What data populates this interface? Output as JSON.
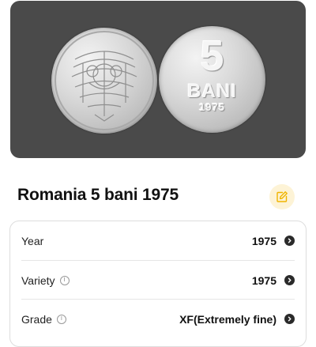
{
  "coin_image": {
    "reverse_value": "5",
    "reverse_unit": "BANI",
    "reverse_year": "1975"
  },
  "title": "Romania 5 bani 1975",
  "details": [
    {
      "label": "Year",
      "value": "1975",
      "info": false
    },
    {
      "label": "Variety",
      "value": "1975",
      "info": true
    },
    {
      "label": "Grade",
      "value": "XF(Extremely fine)",
      "info": true
    }
  ],
  "icons": {
    "edit": "edit-icon",
    "info": "info-icon",
    "chevron": "chevron-right-icon"
  },
  "colors": {
    "photo_bg": "#4a4a4a",
    "edit_bg": "#fdf3d6",
    "edit_icon": "#f0b400"
  }
}
